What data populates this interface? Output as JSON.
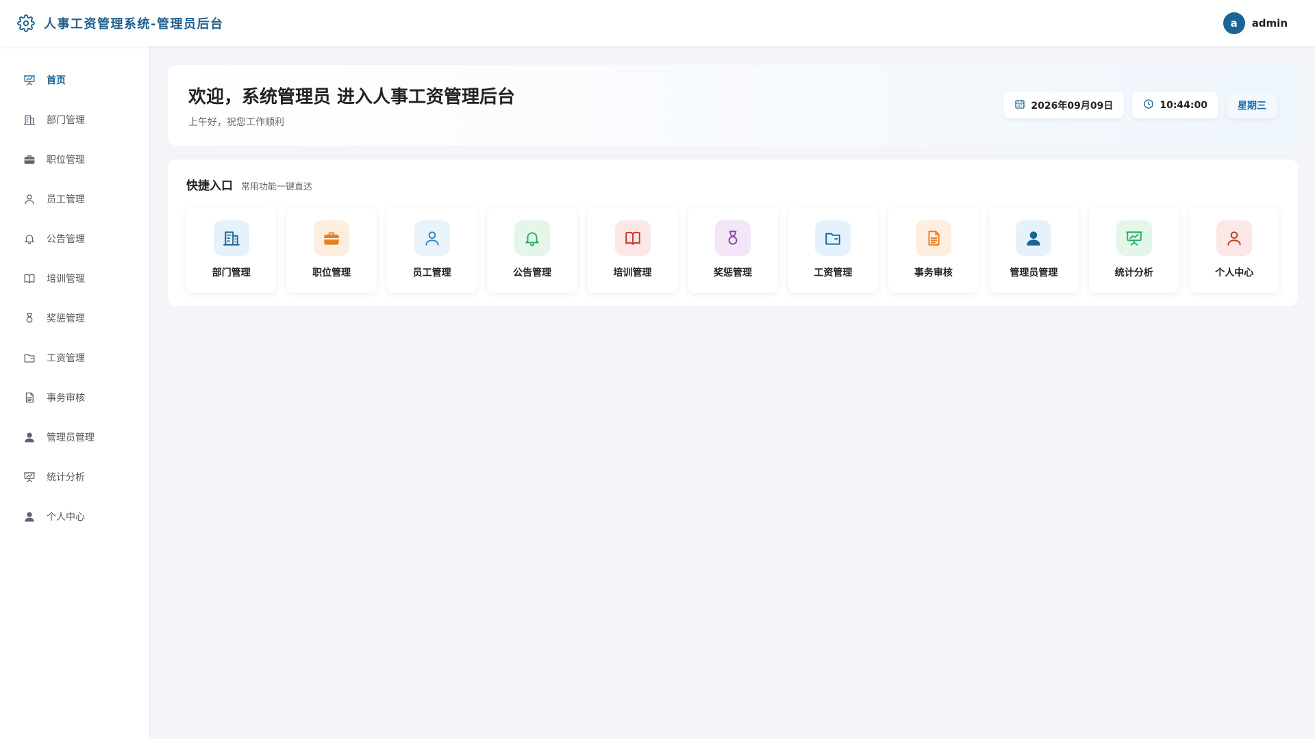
{
  "header": {
    "title": "人事工资管理系统-管理员后台",
    "avatar_letter": "a",
    "username": "admin"
  },
  "sidebar": {
    "items": [
      {
        "label": "首页",
        "icon": "chart-board-icon",
        "active": true
      },
      {
        "label": "部门管理",
        "icon": "building-icon"
      },
      {
        "label": "职位管理",
        "icon": "briefcase-icon"
      },
      {
        "label": "员工管理",
        "icon": "user-icon"
      },
      {
        "label": "公告管理",
        "icon": "bell-icon"
      },
      {
        "label": "培训管理",
        "icon": "book-icon"
      },
      {
        "label": "奖惩管理",
        "icon": "medal-icon"
      },
      {
        "label": "工资管理",
        "icon": "wallet-icon"
      },
      {
        "label": "事务审核",
        "icon": "document-icon"
      },
      {
        "label": "管理员管理",
        "icon": "user-solid-icon"
      },
      {
        "label": "统计分析",
        "icon": "chart-board-icon"
      },
      {
        "label": "个人中心",
        "icon": "user-solid-icon"
      }
    ]
  },
  "welcome": {
    "title": "欢迎，系统管理员 进入人事工资管理后台",
    "subtitle": "上午好，祝您工作顺利",
    "date": "2026年09月09日",
    "time": "10:44:00",
    "weekday": "星期三"
  },
  "quick": {
    "title": "快捷入口",
    "subtitle": "常用功能一键直达",
    "cards": [
      {
        "label": "部门管理",
        "icon": "building-icon",
        "color": "#1a6496",
        "bg": "#e6f2fb"
      },
      {
        "label": "职位管理",
        "icon": "briefcase-icon",
        "color": "#e67e22",
        "bg": "#fdeedf"
      },
      {
        "label": "员工管理",
        "icon": "user-icon",
        "color": "#2e86c1",
        "bg": "#e8f3fb"
      },
      {
        "label": "公告管理",
        "icon": "bell-icon",
        "color": "#27ae60",
        "bg": "#e4f6ea"
      },
      {
        "label": "培训管理",
        "icon": "book-icon",
        "color": "#c0392b",
        "bg": "#fbe7e5"
      },
      {
        "label": "奖惩管理",
        "icon": "medal-icon",
        "color": "#8e44ad",
        "bg": "#f2e6f7"
      },
      {
        "label": "工资管理",
        "icon": "wallet-icon",
        "color": "#1a6496",
        "bg": "#e6f2fb"
      },
      {
        "label": "事务审核",
        "icon": "document-icon",
        "color": "#e67e22",
        "bg": "#fdeedf"
      },
      {
        "label": "管理员管理",
        "icon": "user-solid-icon",
        "color": "#1a6496",
        "bg": "#e6f2fb"
      },
      {
        "label": "统计分析",
        "icon": "chart-board-icon",
        "color": "#27ae60",
        "bg": "#e4f6ea"
      },
      {
        "label": "个人中心",
        "icon": "user-icon",
        "color": "#c0392b",
        "bg": "#fbe7e5"
      }
    ]
  }
}
